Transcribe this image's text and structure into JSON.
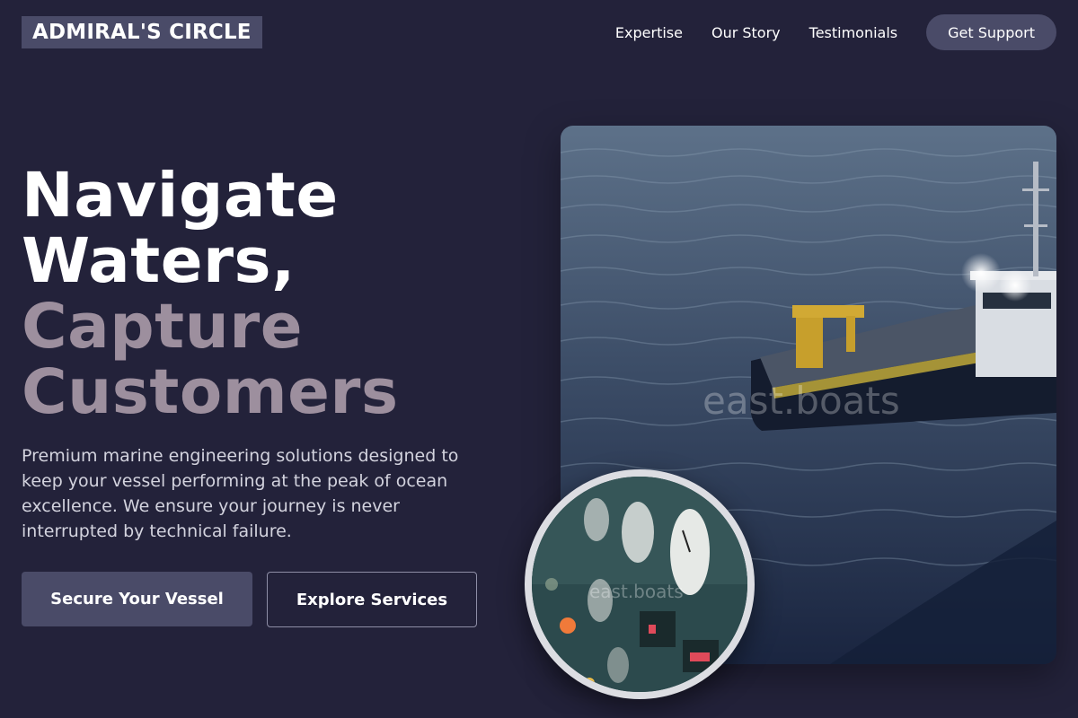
{
  "header": {
    "logo": "ADMIRAL'S CIRCLE",
    "nav": [
      "Expertise",
      "Our Story",
      "Testimonials"
    ],
    "cta": "Get Support"
  },
  "hero": {
    "headline": [
      "Navigate",
      "Waters,",
      "Capture",
      "Customers"
    ],
    "description": "Premium marine engineering solutions designed to keep your vessel performing at the peak of ocean excellence. We ensure your journey is never interrupted by technical failure.",
    "primary_button": "Secure Your Vessel",
    "secondary_button": "Explore Services"
  },
  "media": {
    "main_image": "ship-at-sea-photo",
    "inset_image": "gauges-panel-photo",
    "watermark": "east.boats"
  },
  "colors": {
    "background": "#23223a",
    "accent": "#4a4b68",
    "muted_headline": "#9d8f9e"
  }
}
